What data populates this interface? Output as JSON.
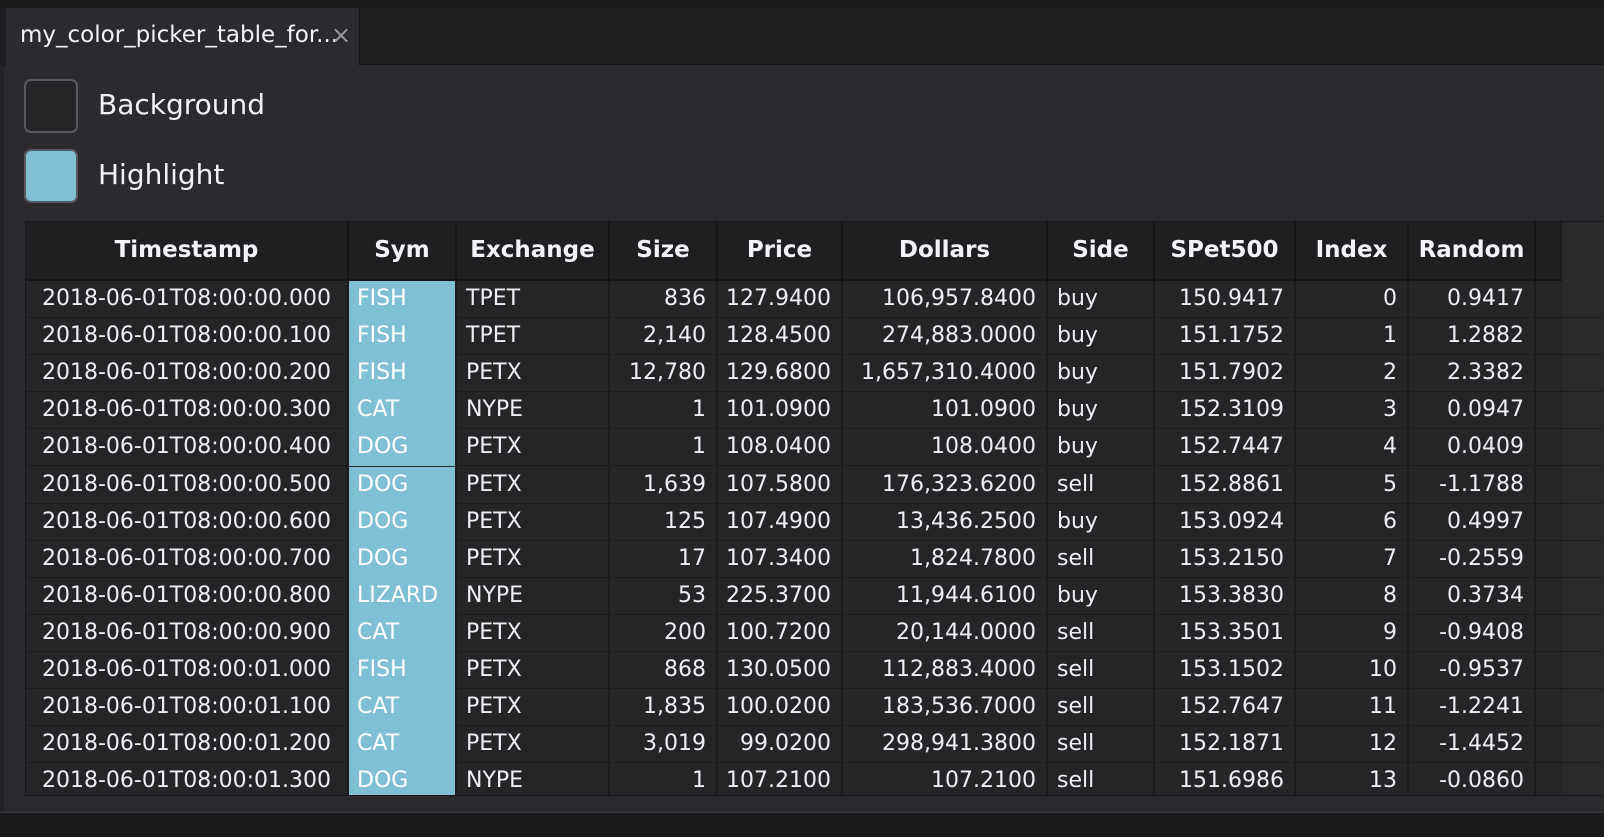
{
  "tab": {
    "title": "my_color_picker_table_for...",
    "close_glyph": "×"
  },
  "pickers": [
    {
      "label": "Background",
      "color": "#252427"
    },
    {
      "label": "Highlight",
      "color": "#7fc0d5"
    }
  ],
  "table": {
    "columns": [
      "Timestamp",
      "Sym",
      "Exchange",
      "Size",
      "Price",
      "Dollars",
      "Side",
      "SPet500",
      "Index",
      "Random"
    ],
    "rows": [
      [
        "2018-06-01T08:00:00.000",
        "FISH",
        "TPET",
        "836",
        "127.9400",
        "106,957.8400",
        "buy",
        "150.9417",
        "0",
        "0.9417"
      ],
      [
        "2018-06-01T08:00:00.100",
        "FISH",
        "TPET",
        "2,140",
        "128.4500",
        "274,883.0000",
        "buy",
        "151.1752",
        "1",
        "1.2882"
      ],
      [
        "2018-06-01T08:00:00.200",
        "FISH",
        "PETX",
        "12,780",
        "129.6800",
        "1,657,310.4000",
        "buy",
        "151.7902",
        "2",
        "2.3382"
      ],
      [
        "2018-06-01T08:00:00.300",
        "CAT",
        "NYPE",
        "1",
        "101.0900",
        "101.0900",
        "buy",
        "152.3109",
        "3",
        "0.0947"
      ],
      [
        "2018-06-01T08:00:00.400",
        "DOG",
        "PETX",
        "1",
        "108.0400",
        "108.0400",
        "buy",
        "152.7447",
        "4",
        "0.0409"
      ],
      [
        "2018-06-01T08:00:00.500",
        "DOG",
        "PETX",
        "1,639",
        "107.5800",
        "176,323.6200",
        "sell",
        "152.8861",
        "5",
        "-1.1788"
      ],
      [
        "2018-06-01T08:00:00.600",
        "DOG",
        "PETX",
        "125",
        "107.4900",
        "13,436.2500",
        "buy",
        "153.0924",
        "6",
        "0.4997"
      ],
      [
        "2018-06-01T08:00:00.700",
        "DOG",
        "PETX",
        "17",
        "107.3400",
        "1,824.7800",
        "sell",
        "153.2150",
        "7",
        "-0.2559"
      ],
      [
        "2018-06-01T08:00:00.800",
        "LIZARD",
        "NYPE",
        "53",
        "225.3700",
        "11,944.6100",
        "buy",
        "153.3830",
        "8",
        "0.3734"
      ],
      [
        "2018-06-01T08:00:00.900",
        "CAT",
        "PETX",
        "200",
        "100.7200",
        "20,144.0000",
        "sell",
        "153.3501",
        "9",
        "-0.9408"
      ],
      [
        "2018-06-01T08:00:01.000",
        "FISH",
        "PETX",
        "868",
        "130.0500",
        "112,883.4000",
        "sell",
        "153.1502",
        "10",
        "-0.9537"
      ],
      [
        "2018-06-01T08:00:01.100",
        "CAT",
        "PETX",
        "1,835",
        "100.0200",
        "183,536.7000",
        "sell",
        "152.7647",
        "11",
        "-1.2241"
      ],
      [
        "2018-06-01T08:00:01.200",
        "CAT",
        "PETX",
        "3,019",
        "99.0200",
        "298,941.3800",
        "sell",
        "152.1871",
        "12",
        "-1.4452"
      ],
      [
        "2018-06-01T08:00:01.300",
        "DOG",
        "NYPE",
        "1",
        "107.2100",
        "107.2100",
        "sell",
        "151.6986",
        "13",
        "-0.0860"
      ]
    ]
  }
}
